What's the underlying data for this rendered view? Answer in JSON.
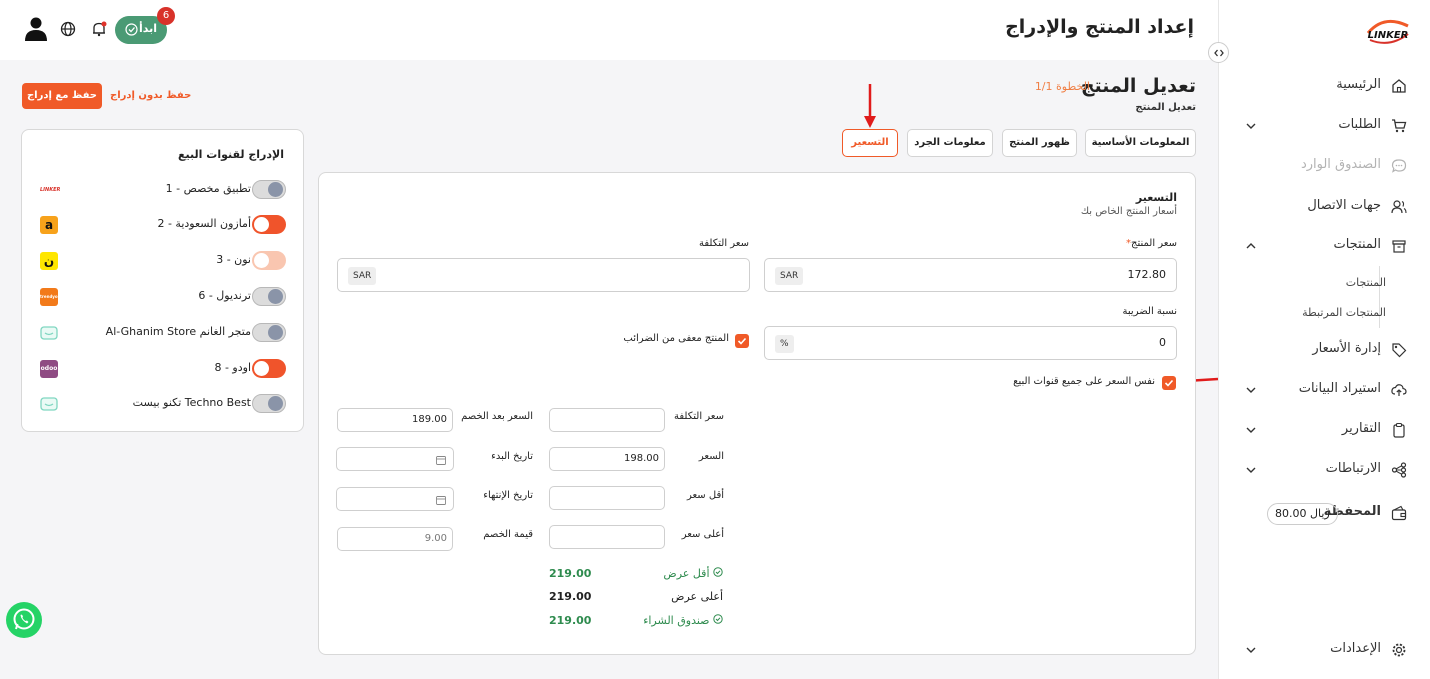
{
  "header": {
    "page_title": "إعداد المنتج والإدراج",
    "start_label": "ابدأ",
    "start_badge": "6"
  },
  "sidebar": {
    "logo_text": "LINKER",
    "items": [
      {
        "label": "الرئيسية",
        "icon": "home-icon"
      },
      {
        "label": "الطلبات",
        "icon": "cart-icon"
      },
      {
        "label": "الصندوق الوارد",
        "icon": "chat-icon"
      },
      {
        "label": "جهات الاتصال",
        "icon": "contacts-icon"
      },
      {
        "label": "المنتجات",
        "icon": "box-icon"
      },
      {
        "label": "إدارة الأسعار",
        "icon": "tag-icon"
      },
      {
        "label": "استيراد البيانات",
        "icon": "upload-icon"
      },
      {
        "label": "التقارير",
        "icon": "clipboard-icon"
      },
      {
        "label": "الارتباطات",
        "icon": "share-icon"
      },
      {
        "label": "المحفظة",
        "icon": "wallet-icon"
      },
      {
        "label": "الإعدادات",
        "icon": "gear-icon"
      }
    ],
    "sub_items": [
      "المنتجات",
      "المنتجات المرتبطة"
    ],
    "wallet_amount": "80.00 ريال"
  },
  "page": {
    "title": "تعديل المنتج",
    "step": "الخطوة 1/1",
    "subtitle": "تعديل المنتج",
    "save_with_listing": "حفظ مع إدراج",
    "save_without_listing": "حفظ بدون إدراج"
  },
  "tabs": [
    {
      "label": "المعلومات الأساسية"
    },
    {
      "label": "ظهور المنتج"
    },
    {
      "label": "معلومات الجرد"
    },
    {
      "label": "التسعير"
    }
  ],
  "pricing": {
    "section_title": "التسعير",
    "section_subtitle": "أسعار المنتج الخاص بك",
    "product_price_label": "سعر المنتج",
    "required_mark": "*",
    "product_price_value": "172.80",
    "currency": "SAR",
    "cost_price_label": "سعر التكلفة",
    "tax_label": "نسبة الضريبة",
    "tax_value": "0",
    "tax_unit": "%",
    "tax_exempt_label": "المنتج معفى من الضرائب",
    "same_price_label": "نفس السعر على جميع قنوات البيع"
  },
  "channel_pricing": {
    "cost_label": "سعر التكلفة",
    "price_label": "السعر",
    "price_value": "198.00",
    "min_price_label": "أقل سعر",
    "max_price_label": "أعلى سعر",
    "after_discount_label": "السعر بعد الخصم",
    "after_discount_value": "189.00",
    "start_date_label": "تاريخ البدء",
    "end_date_label": "تاريخ الإنتهاء",
    "discount_label": "قيمة الخصم",
    "discount_value": "9.00"
  },
  "summary": [
    {
      "label": "أقل عرض",
      "value": "219.00",
      "check": true
    },
    {
      "label": "أعلى عرض",
      "value": "219.00",
      "check": false
    },
    {
      "label": "صندوق الشراء",
      "value": "219.00",
      "check": true
    }
  ],
  "channels": {
    "title": "الإدراج لقنوات البيع",
    "items": [
      {
        "label": "تطبيق مخصص - 1",
        "state": "off",
        "logo_text": "LINKER"
      },
      {
        "label": "أمازون السعودية - 2",
        "state": "on",
        "logo_text": "a"
      },
      {
        "label": "نون - 3",
        "state": "pale",
        "logo_text": "ن"
      },
      {
        "label": "ترنديول - 6",
        "state": "off",
        "logo_text": "trendyol"
      },
      {
        "label": "Al-Ghanim Store متجر الغانم",
        "state": "off",
        "logo_text": ""
      },
      {
        "label": "اودو - 8",
        "state": "on",
        "logo_text": "odoo"
      },
      {
        "label": "تكنو بيست Techno Best",
        "state": "off",
        "logo_text": ""
      }
    ]
  },
  "colors": {
    "accent": "#f05a28",
    "green": "#2e8b4e",
    "start_btn": "#4a9a74"
  }
}
